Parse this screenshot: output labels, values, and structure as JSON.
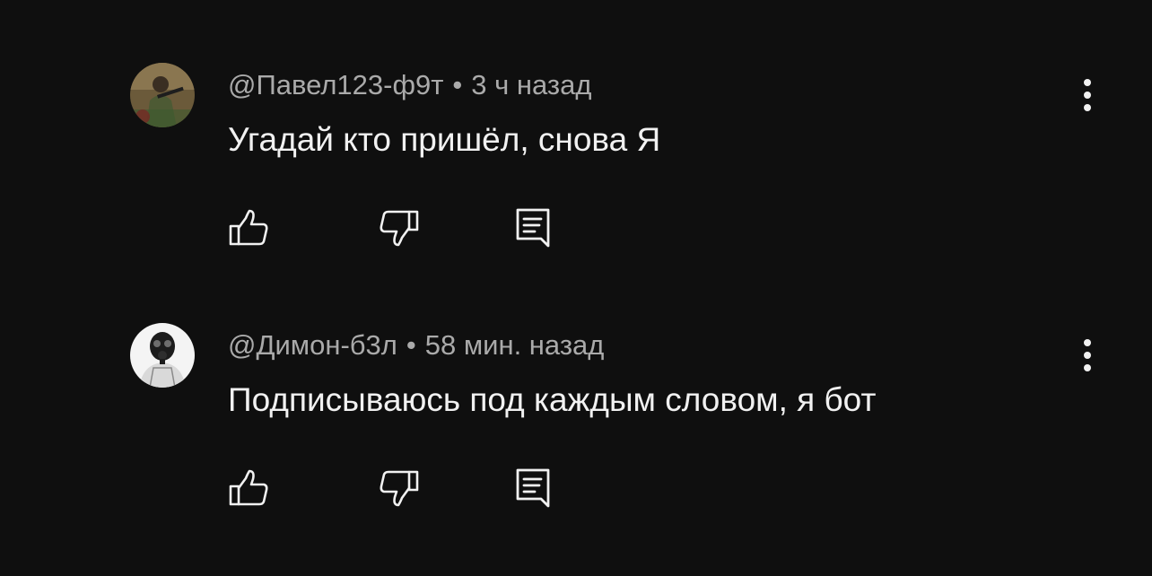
{
  "comments": [
    {
      "author": "@Павел123-ф9т",
      "separator": "•",
      "time": "3 ч назад",
      "text": "Угадай кто пришёл, снова Я",
      "avatar_icon": "soldier-avatar"
    },
    {
      "author": "@Димон-б3л",
      "separator": "•",
      "time": "58 мин. назад",
      "text": "Подписываюсь под каждым словом, я бот",
      "avatar_icon": "gas-mask-avatar"
    }
  ],
  "icons": {
    "like": "thumbs-up-icon",
    "dislike": "thumbs-down-icon",
    "reply": "reply-icon",
    "menu": "more-vert-icon"
  },
  "colors": {
    "background": "#0f0f0f",
    "text": "#f1f1f1",
    "meta": "#aaaaaa"
  }
}
